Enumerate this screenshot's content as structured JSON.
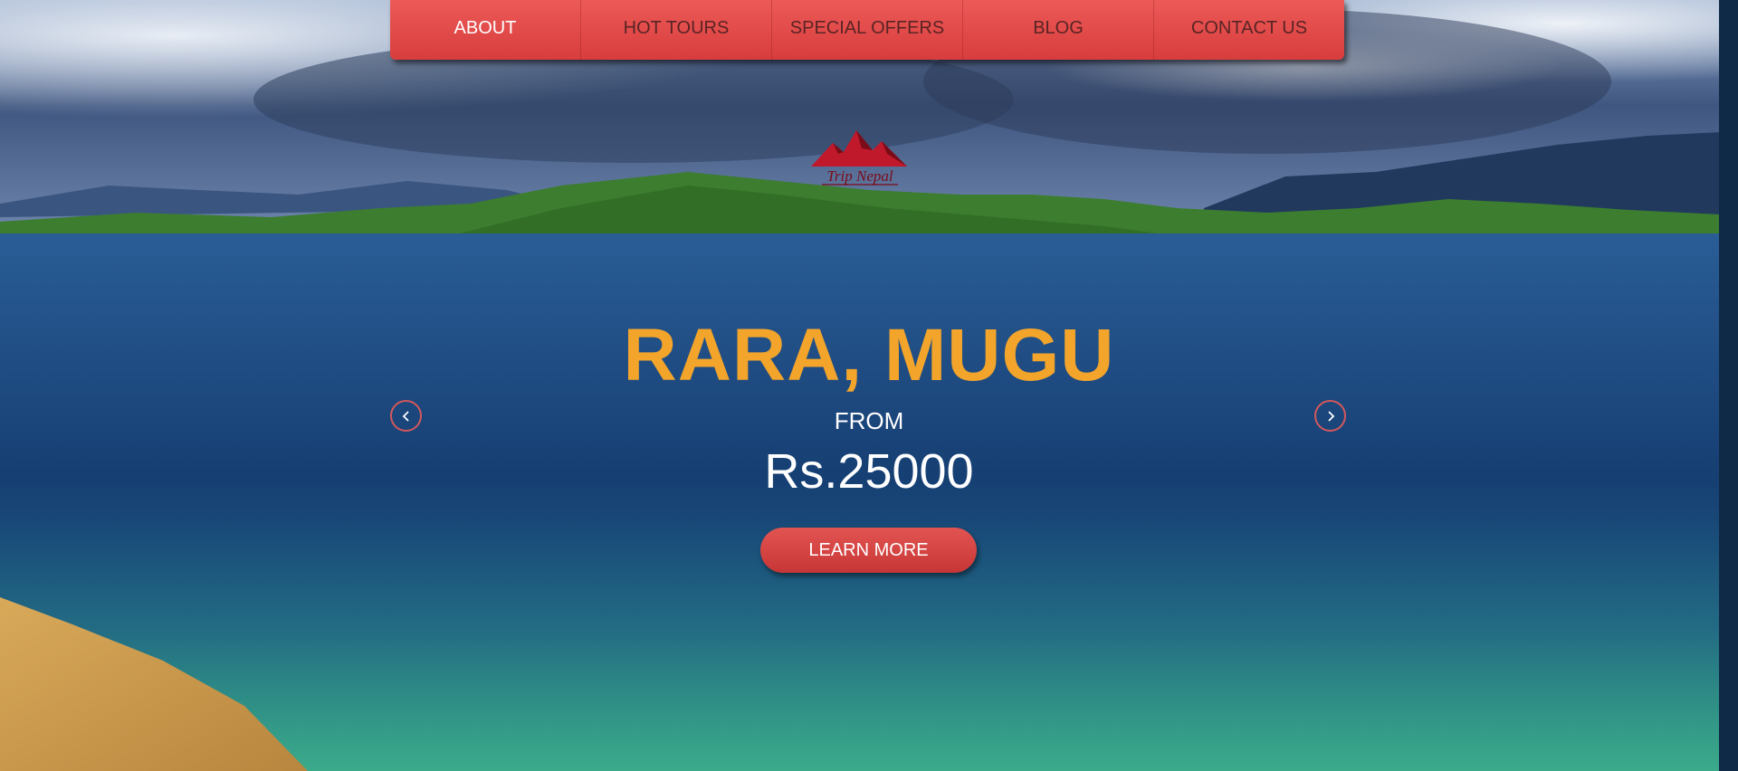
{
  "nav": {
    "items": [
      {
        "label": "ABOUT",
        "active": true
      },
      {
        "label": "HOT TOURS",
        "active": false
      },
      {
        "label": "SPECIAL OFFERS",
        "active": false
      },
      {
        "label": "BLOG",
        "active": false
      },
      {
        "label": "CONTACT US",
        "active": false
      }
    ]
  },
  "logo": {
    "text": "Trip Nepal"
  },
  "hero": {
    "title": "RARA, MUGU",
    "from_label": "FROM",
    "price": "Rs.25000",
    "cta_label": "LEARN MORE"
  },
  "carousel": {
    "prev_icon": "chevron-left-icon",
    "next_icon": "chevron-right-icon"
  },
  "colors": {
    "accent": "#e04a48",
    "title": "#f2a42b",
    "text": "#ffffff"
  }
}
